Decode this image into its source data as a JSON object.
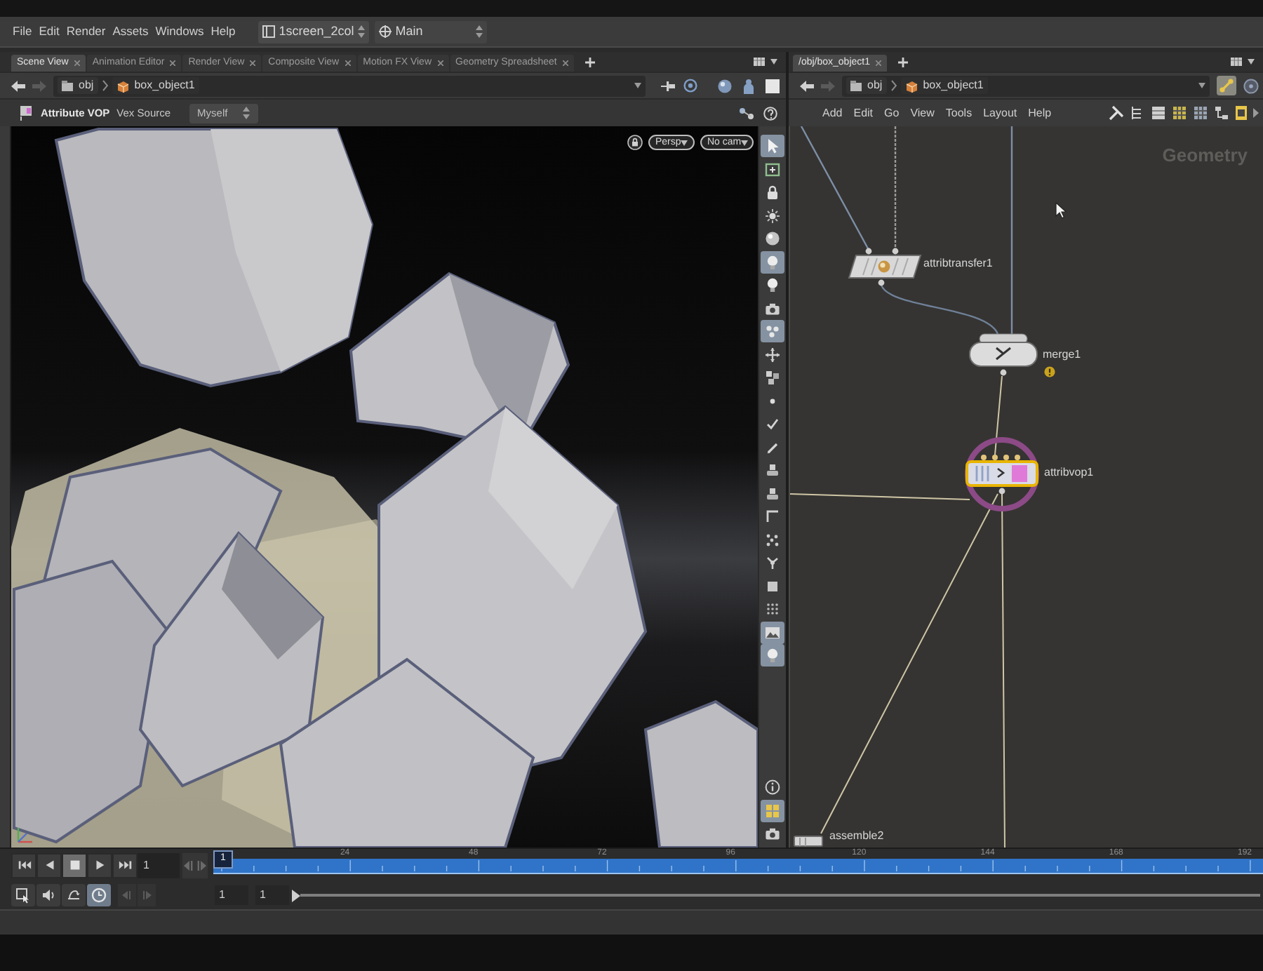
{
  "menu_bar": {
    "items": [
      "File",
      "Edit",
      "Render",
      "Assets",
      "Windows",
      "Help"
    ],
    "desktop": "1screen_2col",
    "network": "Main"
  },
  "scene_pane": {
    "tabs": [
      {
        "label": "Scene View",
        "selected": true
      },
      {
        "label": "Animation Editor",
        "selected": false
      },
      {
        "label": "Render View",
        "selected": false
      },
      {
        "label": "Composite View",
        "selected": false
      },
      {
        "label": "Motion FX View",
        "selected": false
      },
      {
        "label": "Geometry Spreadsheet",
        "selected": false
      }
    ],
    "path": [
      "obj",
      "box_object1"
    ],
    "operator": {
      "title": "Attribute VOP",
      "source_label": "Vex Source",
      "source_value": "Myself"
    },
    "view_menus": [
      "Persp",
      "No cam"
    ],
    "toolbar": [
      {
        "kind": "select",
        "on": true
      },
      {
        "kind": "frame",
        "on": false
      },
      {
        "kind": "lock",
        "on": false
      },
      {
        "kind": "sun",
        "on": false
      },
      {
        "kind": "sphere",
        "on": false
      },
      {
        "kind": "bulb",
        "on": true
      },
      {
        "kind": "bulb",
        "on": false
      },
      {
        "kind": "camera",
        "on": false
      },
      {
        "kind": "dots",
        "on": true
      },
      {
        "kind": "move",
        "on": false
      },
      {
        "kind": "cubes",
        "on": false
      },
      {
        "kind": "dot",
        "on": false
      },
      {
        "kind": "check",
        "on": false
      },
      {
        "kind": "pen",
        "on": false
      },
      {
        "kind": "stamp",
        "on": false
      },
      {
        "kind": "stamp",
        "on": false
      },
      {
        "kind": "corner",
        "on": false
      },
      {
        "kind": "scatter",
        "on": false
      },
      {
        "kind": "branch",
        "on": false
      },
      {
        "kind": "square",
        "on": false
      },
      {
        "kind": "grid",
        "on": false
      },
      {
        "kind": "image",
        "on": true
      },
      {
        "kind": "bulb",
        "on": true
      }
    ],
    "toolbar_bottom": [
      {
        "kind": "info",
        "on": false
      },
      {
        "kind": "tiles",
        "on": true
      },
      {
        "kind": "camera",
        "on": false
      }
    ]
  },
  "network_pane": {
    "tabs": [
      {
        "label": "/obj/box_object1",
        "selected": true
      }
    ],
    "path": [
      "obj",
      "box_object1"
    ],
    "menu": [
      "Add",
      "Edit",
      "Go",
      "View",
      "Tools",
      "Layout",
      "Help"
    ],
    "context": "Geometry",
    "nodes": [
      {
        "name": "attribtransfer1",
        "kind": "transfer",
        "selected": false,
        "current": false,
        "warning": false
      },
      {
        "name": "merge1",
        "kind": "merge",
        "selected": false,
        "current": false,
        "warning": true
      },
      {
        "name": "attribvop1",
        "kind": "vop",
        "selected": true,
        "current": true,
        "warning": false
      },
      {
        "name": "assemble2",
        "kind": "assemble",
        "selected": false,
        "current": false,
        "warning": false
      }
    ]
  },
  "timeline": {
    "transport": [
      {
        "kind": "first",
        "on": false
      },
      {
        "kind": "reverse",
        "on": false
      },
      {
        "kind": "stop",
        "on": true
      },
      {
        "kind": "play",
        "on": false
      },
      {
        "kind": "last",
        "on": false
      }
    ],
    "frame": "1",
    "marker": "1",
    "ticks": [
      "24",
      "48",
      "72",
      "96",
      "120",
      "144",
      "168",
      "192"
    ],
    "range_start": "1",
    "range_end": "1",
    "tools": [
      {
        "kind": "keys",
        "on": false
      },
      {
        "kind": "audio",
        "on": false
      },
      {
        "kind": "loop",
        "on": false
      },
      {
        "kind": "realtime",
        "on": true
      }
    ],
    "key_step_disabled": true
  }
}
